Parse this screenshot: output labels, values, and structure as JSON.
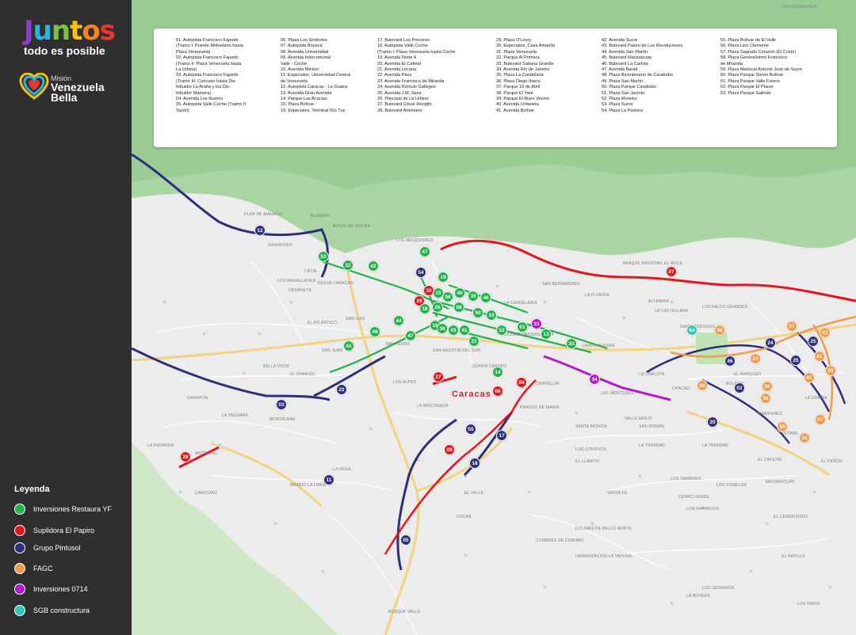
{
  "brand": {
    "juntos_letters": [
      "J",
      "u",
      "n",
      "t",
      "o",
      "s"
    ],
    "tagline": "todo es posible",
    "mision_small": "Misión",
    "mision_line1": "Venezuela",
    "mision_line2": "Bella"
  },
  "legend": {
    "title": "Leyenda",
    "items": [
      {
        "label": "Inversiones Restaura YF",
        "color": "#22b24c"
      },
      {
        "label": "Suplidora El Papiro",
        "color": "#e8141b"
      },
      {
        "label": "Grupo Pintusol",
        "color": "#2b2f7e"
      },
      {
        "label": "FAGC",
        "color": "#f59a4a"
      },
      {
        "label": "Inversiones 0714",
        "color": "#b41ac9"
      },
      {
        "label": "SGB constructura",
        "color": "#2ec7b8"
      }
    ]
  },
  "index": {
    "col1": [
      "01.  Autopista Francisco Fajardo",
      "      (Tramo I: Puente Mohedano hasta",
      "      Plaza Venezuela)",
      "02.  Autopista Francisco Fajardo",
      "      (Tramo II: Plaza Venezuela hasta",
      "      La Urbina)",
      "03.  Autopista Francisco Fajardo",
      "      (Tramo III: Caricuao hasta Dis-",
      "      tribuidor La Araña y los Dis-",
      "      tribuidor Mamera)",
      "04.  Avenida Los Ilustres",
      "05.  Autopista Valle-Coche (Tramo II:",
      "      Tazón)"
    ],
    "col2": [
      "06.  Plaza Los Símbolos",
      "07.  Autopista Boyacá",
      "08.  Avenida Universidad",
      "09.  Avenida Intercomunal",
      "      Valle - Coche",
      "10.  Avenida México",
      "11.  Especiales, Universidad Central",
      "      de Venezuela",
      "12.  Autopista Caracas - La Guaira",
      "13.  Avenida Gran Avenida",
      "14.  Parque Las Acacias",
      "15.  Plaza Bolívar",
      "16.  Especiales, Terminal Río Tuy"
    ],
    "col3": [
      "17.  Bulevard Los Próceres",
      "18.  Autopista Valle Coche",
      "      (Tramo I: Plaza Venezuela hasta Coche",
      "19.  Avenida Norte 4",
      "20.  Avenida El Cafetal",
      "21.  Avenida Lecuna",
      "22.  Avenida Páez",
      "23.  Avenida Francisco de Miranda",
      "24.  Avenida Rómulo Gallegos",
      "25.  Avenida J.M. Sanz",
      "26.  Principal de La Urbina",
      "27.  Bulevard César Rengifo",
      "28.  Bulevard Antímano"
    ],
    "col4": [
      "29.  Plaza O'Leary",
      "30.  Especiales, Casa Amarilla",
      "31.  Plaza Venezuela",
      "32.  Parque Al Primera",
      "33.  Bulevard Sabana Grande",
      "34.  Avenida Río de Janeiro",
      "35.  Plaza La Candelaria",
      "36.  Plaza Diego Ibarra",
      "37.  Parque 19 de Abril",
      "38.  Parque El Yare",
      "39.  Parque El Buen Vecino",
      "40.  Avenida Urdaneta",
      "41.  Avenida Bolívar"
    ],
    "col5": [
      "42.  Avenida Sucre",
      "43.  Bulevard Paseo de Los Revoluciones",
      "44.  Avenida San Martín",
      "45.  Bulevard Macaracuay",
      "46.  Bulevard La Carlota",
      "47.  Avenida Baralt",
      "48.  Plaza Bicentenario de Carabobo",
      "49.  Plaza San Martín",
      "50.  Plaza Parque Carabobo",
      "51.  Plaza San Jacinto",
      "52.  Plaza Morelos",
      "53.  Plaza Sucre",
      "54.  Plaza La Pastora"
    ],
    "col6": [
      "55.  Plaza Bolívar de El Valle",
      "56.  Plaza Lino Clemente",
      "57.  Plaza Sagrado Corazón (El Cristo)",
      "58.  Plaza Generalísimo Francisco",
      "      de Miranda",
      "59.  Plaza Mariscal Antonio José de Sucre",
      "60.  Plaza Parque Simón Bolívar",
      "61.  Plaza Parque Valle Fresco",
      "62.  Plaza Parque El Placer",
      "63.  Plaza Parque Galindo"
    ]
  },
  "map_labels": {
    "city": "Caracas",
    "places": [
      "PLAN DE MANACO",
      "BLANDIN",
      "ALTOS DE CUTIRA",
      "LOS MECEDORES",
      "GRAMOVEN",
      "CATIA",
      "NUEVA CARACAS",
      "LOS MAGALLANES",
      "URDANETA",
      "EL ATLÁNTICO",
      "BELLA VISTA",
      "CARAPITA",
      "MONTALBÁN",
      "LA YAGUARA",
      "ANTÍMANO",
      "CARICUAO",
      "LA VEGA",
      "EL VALLE",
      "COCHE",
      "LOS CORTIJOS",
      "PETARE",
      "CHACAO",
      "LAS MERCEDES",
      "ALTAMIRA",
      "LA CASTELLANA",
      "LOS PALOS GRANDES",
      "BOLEÍTA",
      "CAMPO ALEGRE",
      "SAN BERNARDINO",
      "LA FLORIDA",
      "EL CAFETAL",
      "MACARACUAY",
      "LA TRINIDAD",
      "LOS POMELOS",
      "SANTA EDUVIGIS",
      "EL PARAÍSO",
      "SAN JUAN",
      "BARRIO LA LINEA",
      "CUMBRES DE CURUMO",
      "CERRO VERDE",
      "LOS NARANJOS",
      "LA BOYERA",
      "EL HATILLO",
      "URBANIZACIÓN LA TAHONA",
      "LOS GERANIOS",
      "BOSQUE VALLE",
      "LOS AGUACATES",
      "CHAPELLÍN",
      "LA URBINA",
      "LOS SAMANES",
      "SANTA FE",
      "SANTA MÓNICA",
      "VALLE ABAJO",
      "PARQUE NACIONAL EL ÁVILA",
      "SAN AGUSTÍN DEL SUR",
      "LOS ALPES",
      "PRADOS DE MARIA",
      "LA PEDRERA",
      "LOS PINOS",
      "EL CEMENTERIO",
      "EL MARQUÉS",
      "LA CARLOTA",
      "SAN ROMÁN",
      "SAN LUIS",
      "LA TRINIDAD",
      "EL PEÑÓN",
      "COLINAS DE BELLO MONTE",
      "EL LLANITO",
      "MARIPEREZ",
      "LA CANDELARIA",
      "CIUDAD UNIVERSITARIA",
      "QUINTA CRESPO",
      "SAN PEDRO",
      "LA RINCONADA"
    ]
  }
}
